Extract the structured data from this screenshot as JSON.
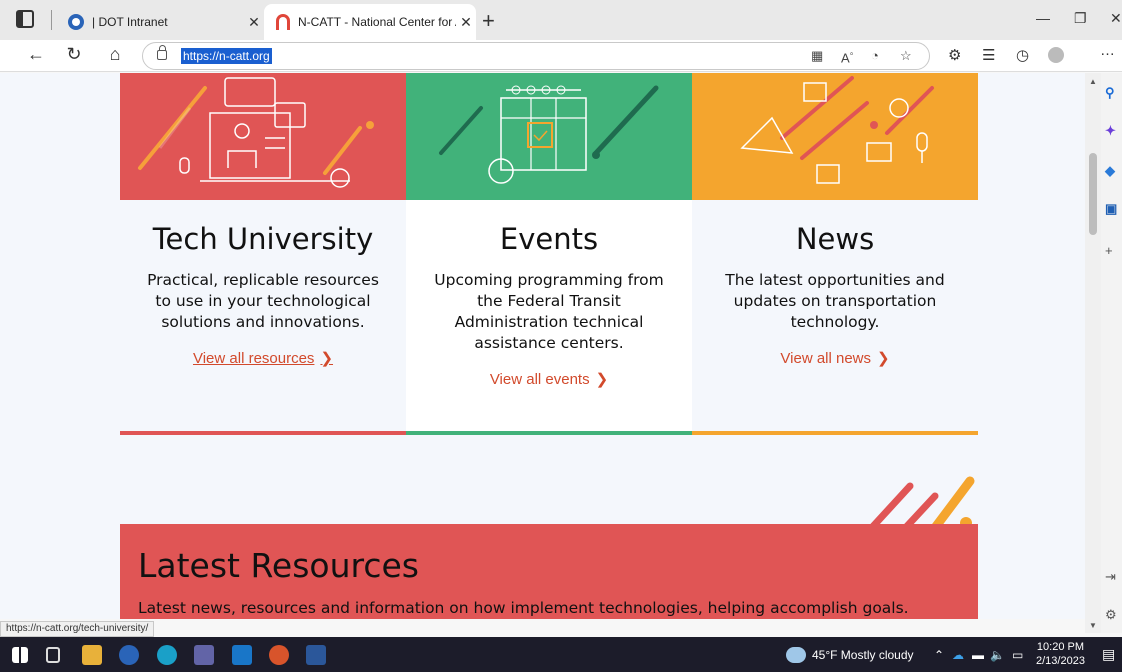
{
  "browser": {
    "tabs": [
      {
        "title": "| DOT Intranet",
        "active": false
      },
      {
        "title": "N-CATT - National Center for Ap",
        "active": true
      }
    ],
    "address": "https://n-catt.org",
    "status_url": "https://n-catt.org/tech-university/"
  },
  "cards": [
    {
      "title": "Tech University",
      "desc": "Practical, replicable resources to use in your technological solutions and innovations.",
      "link": "View all resources",
      "color": "#e05555"
    },
    {
      "title": "Events",
      "desc": "Upcoming programming from the Federal Transit Administration technical assistance centers.",
      "link": "View all events",
      "color": "#41b27a"
    },
    {
      "title": "News",
      "desc": "The latest opportunities and updates on transportation technology.",
      "link": "View all news",
      "color": "#f4a52e"
    }
  ],
  "latest": {
    "title": "Latest Resources",
    "desc": "Latest news, resources and information on how implement technologies, helping accomplish goals."
  },
  "taskbar": {
    "weather": "45°F  Mostly cloudy",
    "time": "10:20 PM",
    "date": "2/13/2023"
  },
  "colors": {
    "accent_red": "#e05555",
    "accent_green": "#41b27a",
    "accent_orange": "#f4a52e",
    "link": "#d24a2c"
  }
}
